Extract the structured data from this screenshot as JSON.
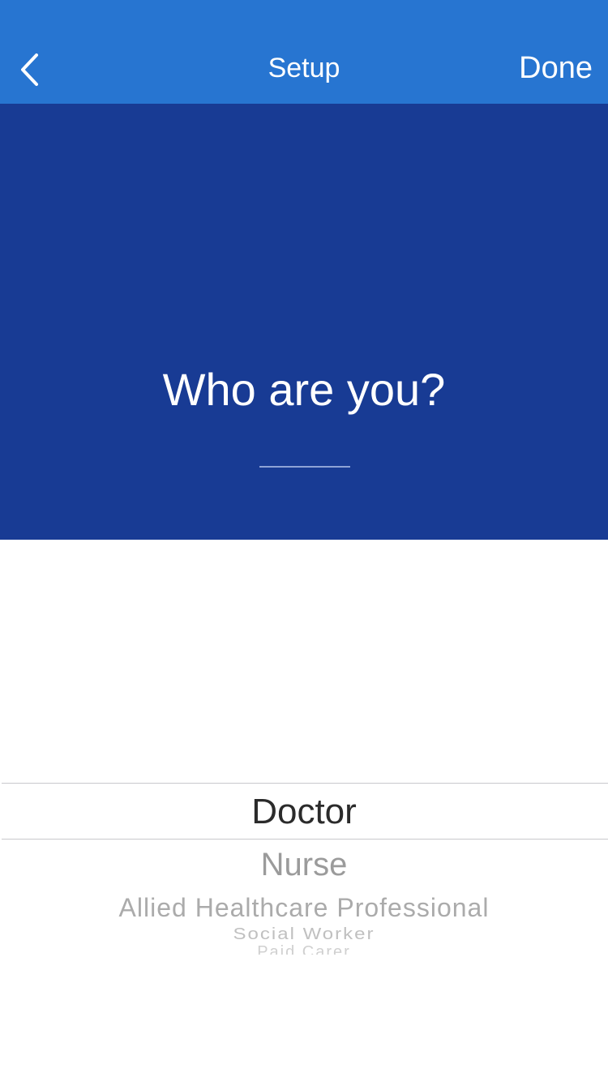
{
  "navbar": {
    "back_icon": "chevron-left-icon",
    "title": "Setup",
    "done_label": "Done",
    "background": "#2775d1"
  },
  "hero": {
    "question": "Who are you?",
    "background": "#183b94"
  },
  "picker": {
    "selected": "Doctor",
    "options": [
      "Doctor",
      "Nurse",
      "Allied Healthcare Professional",
      "Social Worker",
      "Paid Carer"
    ]
  }
}
